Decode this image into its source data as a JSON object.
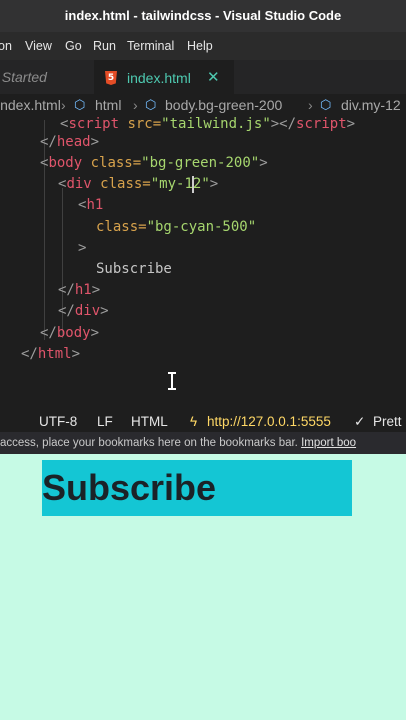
{
  "window": {
    "title": "index.html - tailwindcss - Visual Studio Code"
  },
  "menu": [
    "on",
    "View",
    "Go",
    "Run",
    "Terminal",
    "Help"
  ],
  "tabs": {
    "inactive": "t Started",
    "active": "index.html",
    "active_icon": "5",
    "close": "✕"
  },
  "breadcrumb": {
    "file": "index.html",
    "item1": "html",
    "item2": "body.bg-green-200",
    "item3": "div.my-12"
  },
  "code": {
    "l0": {
      "lt": "<",
      "tag": "script",
      "attr": " src=",
      "val": "\"tailwind.js\"",
      "close": "></",
      "tag2": "script",
      "gt": ">"
    },
    "l1": {
      "open": "</",
      "tag": "head",
      "close": ">"
    },
    "l2": {
      "lt": "<",
      "tag": "body",
      "attr": " class=",
      "val": "\"bg-green-200\"",
      "gt": ">"
    },
    "l3": {
      "lt": "<",
      "tag": "div",
      "attr": " class=",
      "val": "\"my-12\"",
      "gt": ">"
    },
    "l4": {
      "lt": "<",
      "tag": "h1"
    },
    "l5": {
      "attr": "class=",
      "val": "\"bg-cyan-500\""
    },
    "l6": {
      "gt": ">"
    },
    "l7": {
      "text": "Subscribe"
    },
    "l8": {
      "open": "</",
      "tag": "h1",
      "close": ">"
    },
    "l9": {
      "open": "</",
      "tag": "div",
      "close": ">"
    },
    "l10": {
      "open": "</",
      "tag": "body",
      "close": ">"
    },
    "l11": {
      "open": "</",
      "tag": "html",
      "close": ">"
    }
  },
  "status": {
    "encoding": "UTF-8",
    "eol": "LF",
    "language": "HTML",
    "server_url": "http://127.0.0.1:5555",
    "prettier": "Prett"
  },
  "browser": {
    "bookmarks_text": "access, place your bookmarks here on the bookmarks bar.",
    "import_link": "Import boo"
  },
  "preview": {
    "heading": "Subscribe"
  },
  "colors": {
    "bg_green_200": "#c6fae5",
    "bg_cyan_500": "#14c6d4"
  }
}
